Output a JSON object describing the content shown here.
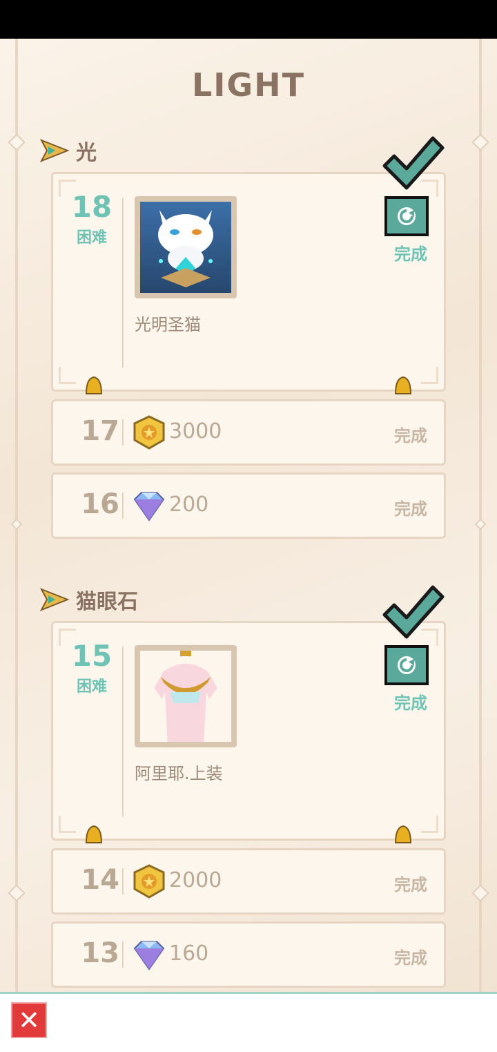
{
  "page": {
    "title": "LIGHT"
  },
  "sections": [
    {
      "title": "光",
      "featured": {
        "level": "18",
        "difficulty": "困难",
        "item_name": "光明圣猫",
        "status": "完成"
      },
      "rows": [
        {
          "level": "17",
          "reward_icon": "coin-icon",
          "amount": "3000",
          "status": "完成"
        },
        {
          "level": "16",
          "reward_icon": "diamond-icon",
          "amount": "200",
          "status": "完成"
        }
      ]
    },
    {
      "title": "猫眼石",
      "featured": {
        "level": "15",
        "difficulty": "困难",
        "item_name": "阿里耶.上装",
        "status": "完成"
      },
      "rows": [
        {
          "level": "14",
          "reward_icon": "coin-icon",
          "amount": "2000",
          "status": "完成"
        },
        {
          "level": "13",
          "reward_icon": "diamond-icon",
          "amount": "160",
          "status": "完成"
        }
      ]
    }
  ],
  "footer": {
    "close_label": "✕"
  },
  "colors": {
    "accent_teal": "#6ec3b4",
    "title_brown": "#8a7362",
    "close_red": "#e23a3a"
  }
}
